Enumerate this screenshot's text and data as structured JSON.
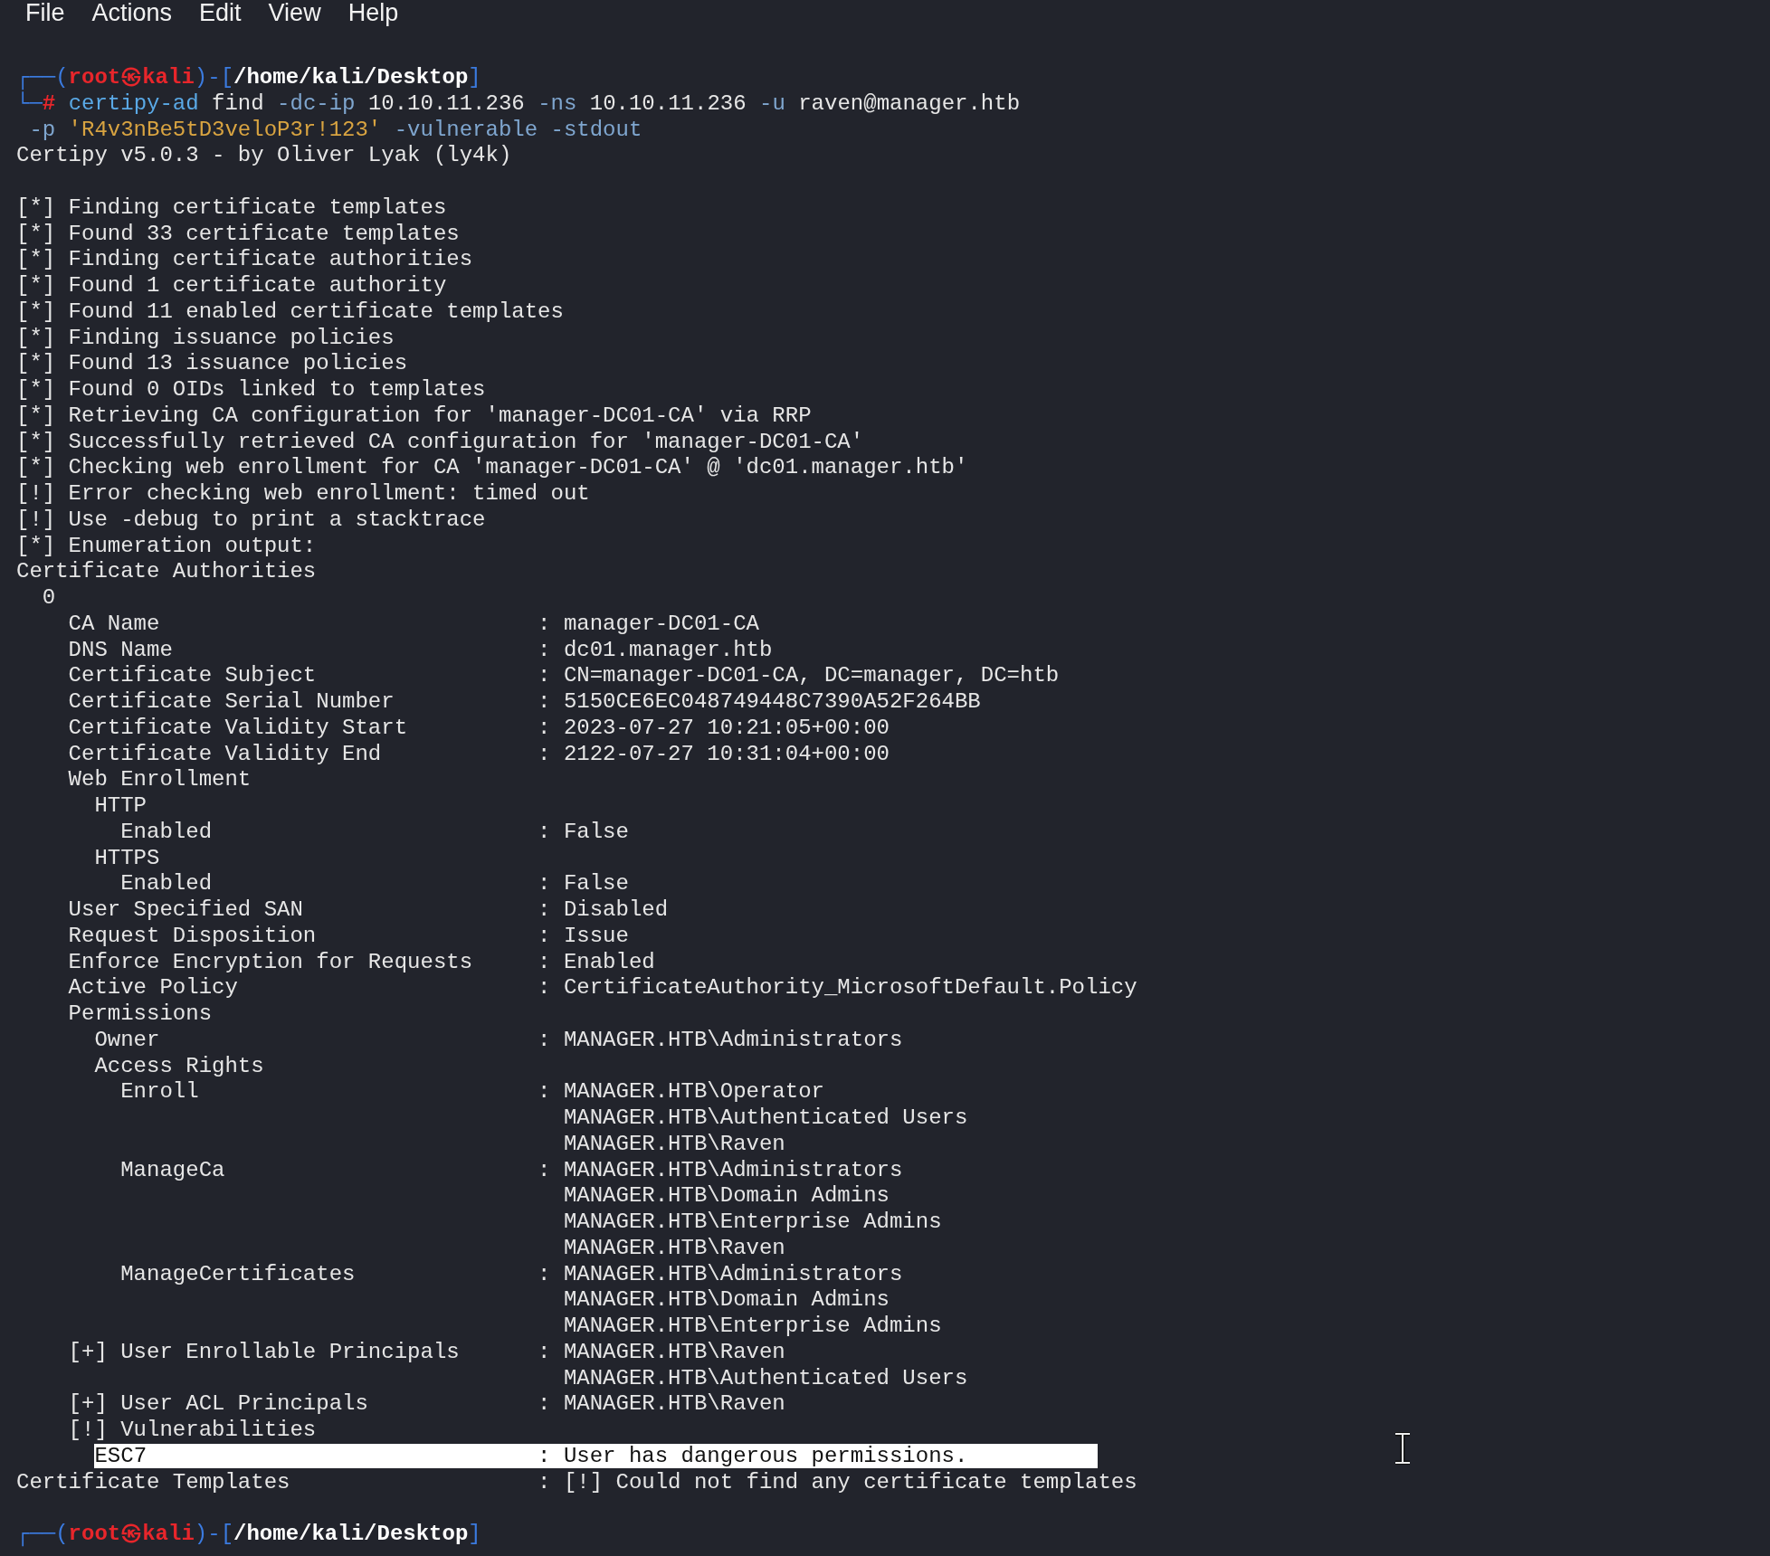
{
  "menu": [
    "File",
    "Actions",
    "Edit",
    "View",
    "Help"
  ],
  "lines": [
    {
      "kind": "segments",
      "segments": [
        {
          "kind": "frame",
          "text": "┌──("
        },
        {
          "kind": "user",
          "text": "root㉿kali"
        },
        {
          "kind": "frame",
          "text": ")-["
        },
        {
          "kind": "path",
          "text": "/home/kali/Desktop"
        },
        {
          "kind": "frame",
          "text": "]"
        }
      ]
    },
    {
      "kind": "segments",
      "segments": [
        {
          "kind": "frame",
          "text": "└─"
        },
        {
          "kind": "user",
          "text": "# "
        },
        {
          "kind": "command",
          "text": "certipy-ad"
        },
        {
          "kind": "plain",
          "text": " find "
        },
        {
          "kind": "option",
          "text": "-dc-ip"
        },
        {
          "kind": "plain",
          "text": " 10.10.11.236 "
        },
        {
          "kind": "option",
          "text": "-ns"
        },
        {
          "kind": "plain",
          "text": " 10.10.11.236 "
        },
        {
          "kind": "option",
          "text": "-u"
        },
        {
          "kind": "plain",
          "text": " raven@manager.htb"
        }
      ]
    },
    {
      "kind": "segments",
      "segments": [
        {
          "kind": "option",
          "text": " -p "
        },
        {
          "kind": "string",
          "text": "'R4v3nBe5tD3veloP3r!123'"
        },
        {
          "kind": "option",
          "text": " -vulnerable -stdout"
        }
      ]
    },
    {
      "kind": "text",
      "text": "Certipy v5.0.3 - by Oliver Lyak (ly4k)"
    },
    {
      "kind": "blank"
    },
    {
      "kind": "text",
      "text": "[*] Finding certificate templates"
    },
    {
      "kind": "text",
      "text": "[*] Found 33 certificate templates"
    },
    {
      "kind": "text",
      "text": "[*] Finding certificate authorities"
    },
    {
      "kind": "text",
      "text": "[*] Found 1 certificate authority"
    },
    {
      "kind": "text",
      "text": "[*] Found 11 enabled certificate templates"
    },
    {
      "kind": "text",
      "text": "[*] Finding issuance policies"
    },
    {
      "kind": "text",
      "text": "[*] Found 13 issuance policies"
    },
    {
      "kind": "text",
      "text": "[*] Found 0 OIDs linked to templates"
    },
    {
      "kind": "text",
      "text": "[*] Retrieving CA configuration for 'manager-DC01-CA' via RRP"
    },
    {
      "kind": "text",
      "text": "[*] Successfully retrieved CA configuration for 'manager-DC01-CA'"
    },
    {
      "kind": "text",
      "text": "[*] Checking web enrollment for CA 'manager-DC01-CA' @ 'dc01.manager.htb'"
    },
    {
      "kind": "text",
      "text": "[!] Error checking web enrollment: timed out"
    },
    {
      "kind": "text",
      "text": "[!] Use -debug to print a stacktrace"
    },
    {
      "kind": "text",
      "text": "[*] Enumeration output:"
    },
    {
      "kind": "text",
      "text": "Certificate Authorities"
    },
    {
      "kind": "text",
      "text": "  0"
    },
    {
      "kind": "field",
      "label": "    CA Name",
      "value": ": manager-DC01-CA",
      "highlighted": false
    },
    {
      "kind": "field",
      "label": "    DNS Name",
      "value": ": dc01.manager.htb",
      "highlighted": false
    },
    {
      "kind": "field",
      "label": "    Certificate Subject",
      "value": ": CN=manager-DC01-CA, DC=manager, DC=htb",
      "highlighted": false
    },
    {
      "kind": "field",
      "label": "    Certificate Serial Number",
      "value": ": 5150CE6EC048749448C7390A52F264BB",
      "highlighted": false
    },
    {
      "kind": "field",
      "label": "    Certificate Validity Start",
      "value": ": 2023-07-27 10:21:05+00:00",
      "highlighted": false
    },
    {
      "kind": "field",
      "label": "    Certificate Validity End",
      "value": ": 2122-07-27 10:31:04+00:00",
      "highlighted": false
    },
    {
      "kind": "text",
      "text": "    Web Enrollment"
    },
    {
      "kind": "text",
      "text": "      HTTP"
    },
    {
      "kind": "field",
      "label": "        Enabled",
      "value": ": False",
      "highlighted": false
    },
    {
      "kind": "text",
      "text": "      HTTPS"
    },
    {
      "kind": "field",
      "label": "        Enabled",
      "value": ": False",
      "highlighted": false
    },
    {
      "kind": "field",
      "label": "    User Specified SAN",
      "value": ": Disabled",
      "highlighted": false
    },
    {
      "kind": "field",
      "label": "    Request Disposition",
      "value": ": Issue",
      "highlighted": false
    },
    {
      "kind": "field",
      "label": "    Enforce Encryption for Requests",
      "value": ": Enabled",
      "highlighted": false
    },
    {
      "kind": "field",
      "label": "    Active Policy",
      "value": ": CertificateAuthority_MicrosoftDefault.Policy",
      "highlighted": false
    },
    {
      "kind": "text",
      "text": "    Permissions"
    },
    {
      "kind": "field",
      "label": "      Owner",
      "value": ": MANAGER.HTB\\Administrators",
      "highlighted": false
    },
    {
      "kind": "text",
      "text": "      Access Rights"
    },
    {
      "kind": "field",
      "label": "        Enroll",
      "value": ": MANAGER.HTB\\Operator",
      "highlighted": false
    },
    {
      "kind": "field",
      "value": "  MANAGER.HTB\\Authenticated Users",
      "highlighted": false
    },
    {
      "kind": "field",
      "value": "  MANAGER.HTB\\Raven",
      "highlighted": false
    },
    {
      "kind": "field",
      "label": "        ManageCa",
      "value": ": MANAGER.HTB\\Administrators",
      "highlighted": false
    },
    {
      "kind": "field",
      "value": "  MANAGER.HTB\\Domain Admins",
      "highlighted": false
    },
    {
      "kind": "field",
      "value": "  MANAGER.HTB\\Enterprise Admins",
      "highlighted": false
    },
    {
      "kind": "field",
      "value": "  MANAGER.HTB\\Raven",
      "highlighted": false
    },
    {
      "kind": "field",
      "label": "        ManageCertificates",
      "value": ": MANAGER.HTB\\Administrators",
      "highlighted": false
    },
    {
      "kind": "field",
      "value": "  MANAGER.HTB\\Domain Admins",
      "highlighted": false
    },
    {
      "kind": "field",
      "value": "  MANAGER.HTB\\Enterprise Admins",
      "highlighted": false
    },
    {
      "kind": "field",
      "label": "    [+] User Enrollable Principals",
      "value": ": MANAGER.HTB\\Raven",
      "highlighted": false
    },
    {
      "kind": "field",
      "value": "  MANAGER.HTB\\Authenticated Users",
      "highlighted": false
    },
    {
      "kind": "field",
      "label": "    [+] User ACL Principals",
      "value": ": MANAGER.HTB\\Raven",
      "highlighted": false
    },
    {
      "kind": "text",
      "text": "    [!] Vulnerabilities"
    },
    {
      "kind": "field",
      "label": "      ESC7",
      "value": ": User has dangerous permissions.",
      "highlighted": true
    },
    {
      "kind": "field",
      "label": "Certificate Templates",
      "value": ": [!] Could not find any certificate templates",
      "highlighted": false
    },
    {
      "kind": "blank"
    },
    {
      "kind": "segments",
      "segments": [
        {
          "kind": "frame",
          "text": "┌──("
        },
        {
          "kind": "user",
          "text": "root㉿kali"
        },
        {
          "kind": "frame",
          "text": ")-["
        },
        {
          "kind": "path",
          "text": "/home/kali/Desktop"
        },
        {
          "kind": "frame",
          "text": "]"
        }
      ]
    }
  ]
}
